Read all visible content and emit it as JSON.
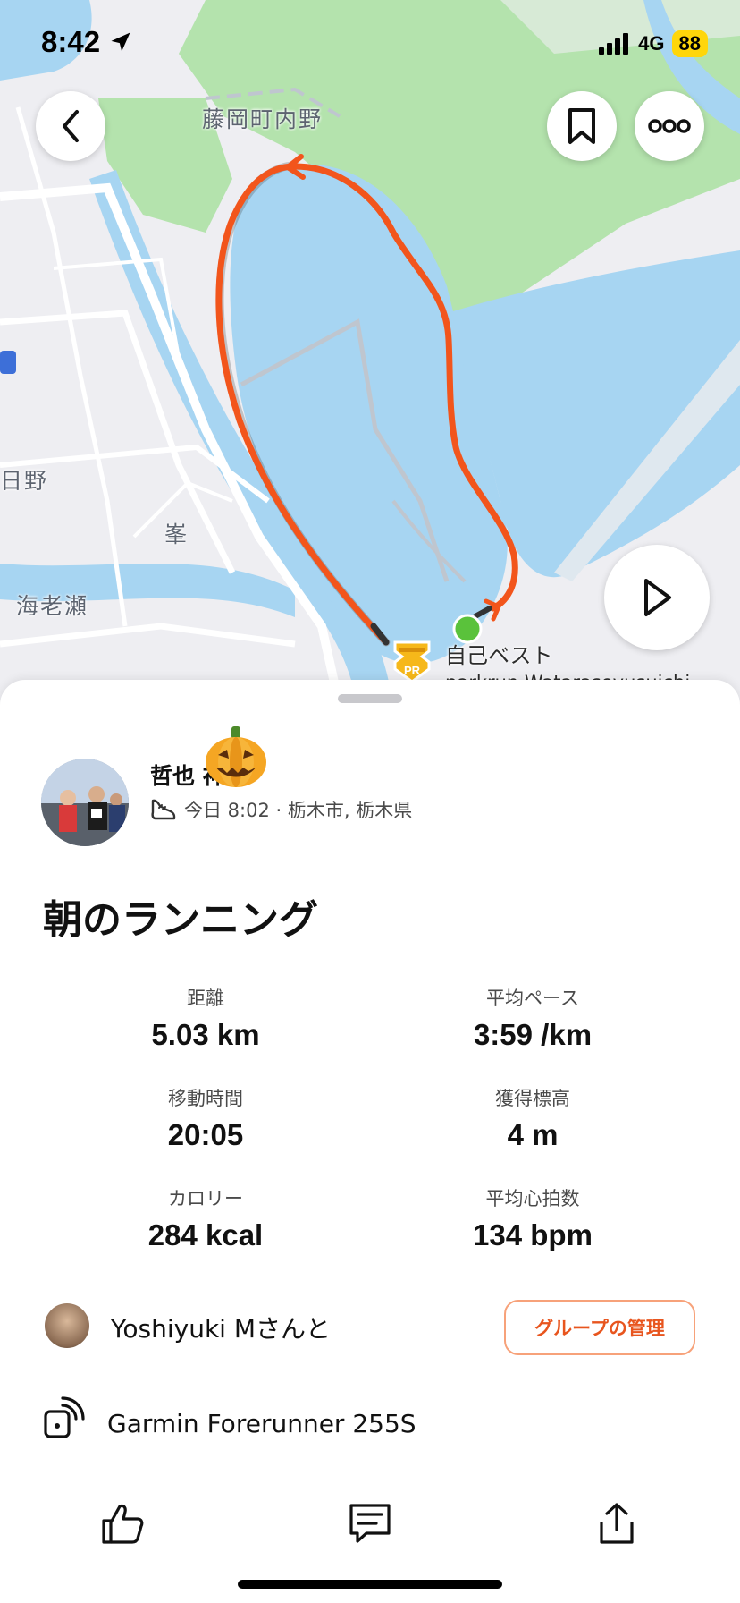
{
  "status_bar": {
    "time": "8:42",
    "network": "4G",
    "battery": "88",
    "icons": [
      "location-arrow-icon",
      "signal-icon",
      "battery-icon"
    ]
  },
  "map": {
    "place_labels": [
      "藤岡町内野",
      "日野",
      "峯",
      "海老瀬"
    ],
    "pr_marker": {
      "badge": "PR",
      "label": "自己ベスト",
      "sublabel": "parkrun Watarasevusuichi"
    },
    "colors": {
      "water": "#a7d5f2",
      "land": "#eeeef2",
      "park": "#b4e3ad",
      "route": "#f2551c",
      "road": "#ffffff",
      "start": "#5ac23b"
    },
    "buttons": [
      "back-icon",
      "bookmark-icon",
      "more-icon",
      "play-icon"
    ]
  },
  "activity": {
    "athlete_name": "哲也 神",
    "timestamp": "今日 8:02 · 栃木市, 栃木県",
    "title": "朝のランニング",
    "stats": [
      {
        "label": "距離",
        "value": "5.03 km"
      },
      {
        "label": "平均ペース",
        "value": "3:59 /km"
      },
      {
        "label": "移動時間",
        "value": "20:05"
      },
      {
        "label": "獲得標高",
        "value": "4 m"
      },
      {
        "label": "カロリー",
        "value": "284 kcal"
      },
      {
        "label": "平均心拍数",
        "value": "134 bpm"
      }
    ],
    "group": {
      "text": "Yoshiyuki Mさんと",
      "button": "グループの管理"
    },
    "device": "Garmin Forerunner 255S",
    "accent_color": "#e8551e"
  },
  "actions": [
    "like-icon",
    "comment-icon",
    "share-icon"
  ]
}
